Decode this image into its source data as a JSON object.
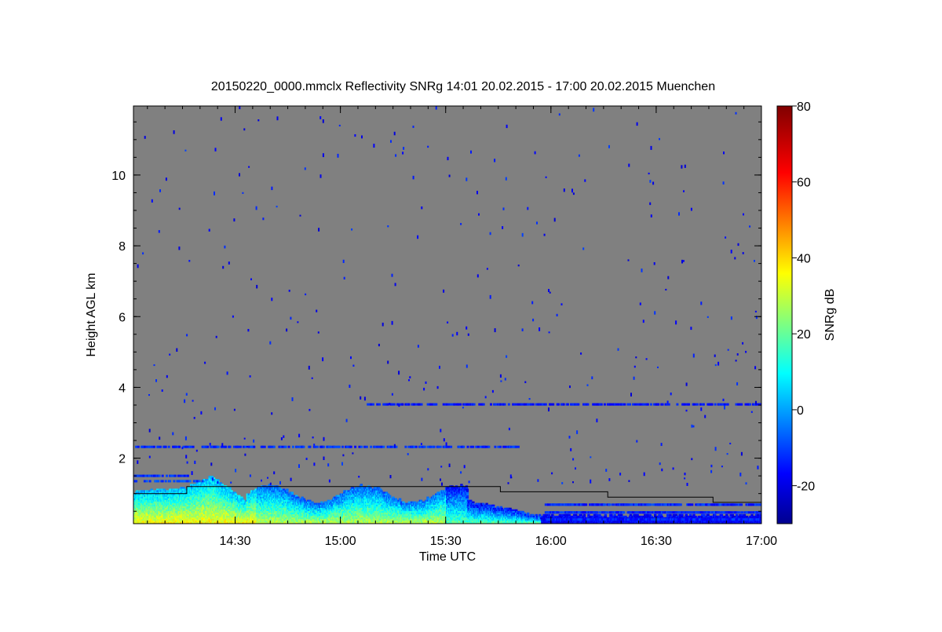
{
  "chart_data": {
    "type": "heatmap",
    "title": "20150220_0000.mmclx Reflectivity SNRg   14:01 20.02.2015 - 17:00 20.02.2015 Muenchen",
    "xlabel": "Time UTC",
    "ylabel": "Height AGL km",
    "colorbar_label": "SNRg dB",
    "x_ticks": [
      {
        "label": "14:30",
        "value": 14.5
      },
      {
        "label": "15:00",
        "value": 15.0
      },
      {
        "label": "15:30",
        "value": 15.5
      },
      {
        "label": "16:00",
        "value": 16.0
      },
      {
        "label": "16:30",
        "value": 16.5
      },
      {
        "label": "17:00",
        "value": 17.0
      }
    ],
    "y_ticks": [
      {
        "label": "2",
        "value": 2
      },
      {
        "label": "4",
        "value": 4
      },
      {
        "label": "6",
        "value": 6
      },
      {
        "label": "8",
        "value": 8
      },
      {
        "label": "10",
        "value": 10
      }
    ],
    "colorbar_ticks": [
      {
        "label": "-20",
        "value": -20
      },
      {
        "label": "0",
        "value": 0
      },
      {
        "label": "20",
        "value": 20
      },
      {
        "label": "40",
        "value": 40
      },
      {
        "label": "60",
        "value": 60
      },
      {
        "label": "80",
        "value": 80
      }
    ],
    "xlim": [
      14.017,
      17.0
    ],
    "ylim": [
      0.15,
      11.95
    ],
    "clim": [
      -30,
      80
    ],
    "background_color": "#808080",
    "colormap": [
      "#00008f",
      "#0000ff",
      "#00ffff",
      "#ffff00",
      "#ff0000",
      "#800000"
    ],
    "boundary_line": {
      "times": [
        14.017,
        14.27,
        14.27,
        14.5,
        14.5,
        15.76,
        15.76,
        16.27,
        16.27,
        16.77,
        16.77,
        17.0
      ],
      "heights": [
        1.0,
        1.0,
        1.2,
        1.2,
        1.2,
        1.2,
        1.05,
        1.05,
        0.9,
        0.9,
        0.75,
        0.75
      ]
    },
    "noise_bands": [
      {
        "height": 2.32,
        "t_start": 14.02,
        "t_end": 15.85,
        "value": -12
      },
      {
        "height": 3.52,
        "t_start": 15.12,
        "t_end": 17.0,
        "value": -15
      },
      {
        "height": 1.35,
        "t_start": 14.02,
        "t_end": 14.35,
        "value": -10
      },
      {
        "height": 1.5,
        "t_start": 14.02,
        "t_end": 14.28,
        "value": -12
      }
    ],
    "echo_layer": {
      "t_start": 14.017,
      "t_end": 17.0,
      "note": ""
    }
  }
}
